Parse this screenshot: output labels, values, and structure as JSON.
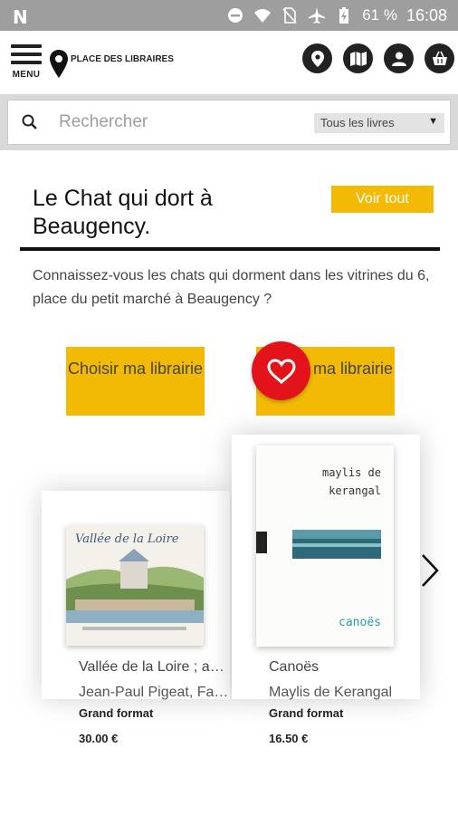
{
  "status_bar": {
    "battery": "61 %",
    "time": "16:08"
  },
  "header": {
    "menu_label": "MENU",
    "logo_text": "PLACE DES LIBRAIRES"
  },
  "search": {
    "placeholder": "Rechercher",
    "filter_value": "Tous les livres"
  },
  "section": {
    "title": "Le Chat qui dort à Beaugency.",
    "see_all": "Voir tout",
    "description": "Connaissez-vous les chats qui dorment dans les vitrines du 6, place du petit marché à Beaugency ?"
  },
  "choose_label": "Choisir ma librairie",
  "books": [
    {
      "title": "Vallée de la Loire ; a…",
      "author": "Jean-Paul Pigeat, Fa…",
      "format": "Grand format",
      "price": "30.00 €",
      "cover_text": "Vallée de la Loire"
    },
    {
      "title": "Canoës",
      "author": "Maylis de Kerangal",
      "format": "Grand format",
      "price": "16.50 €",
      "cover_author": "maylis de kerangal",
      "cover_title": "canoës"
    }
  ],
  "colors": {
    "accent": "#f2b905",
    "heart": "#e3131b",
    "status_bar": "#9e9e9e"
  }
}
